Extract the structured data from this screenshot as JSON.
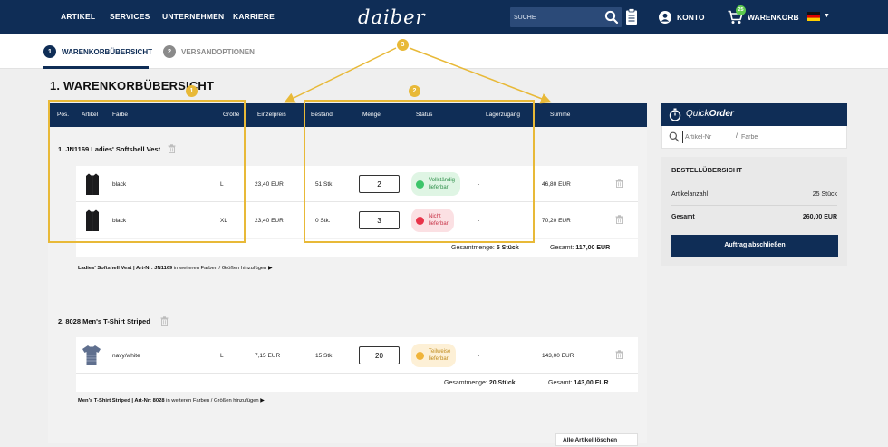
{
  "nav": {
    "links": [
      "ARTIKEL",
      "SERVICES",
      "UNTERNEHMEN",
      "KARRIERE"
    ],
    "logo": "daiber",
    "search_placeholder": "SUCHE",
    "account_label": "KONTO",
    "cart_label": "WARENKORB",
    "cart_count": "25"
  },
  "steps": [
    {
      "num": "1",
      "label": "WARENKORBÜBERSICHT"
    },
    {
      "num": "2",
      "label": "VERSANDOPTIONEN"
    }
  ],
  "page_title": "1. WARENKORBÜBERSICHT",
  "table_headers": {
    "pos": "Pos.",
    "artikel": "Artikel",
    "farbe": "Farbe",
    "groesse": "Größe",
    "einzelpreis": "Einzelpreis",
    "bestand": "Bestand",
    "menge": "Menge",
    "status": "Status",
    "lagerzugang": "Lagerzugang",
    "summe": "Summe"
  },
  "groups": [
    {
      "title": "1. JN1169 Ladies' Softshell Vest",
      "rows": [
        {
          "farbe": "black",
          "groesse": "L",
          "preis": "23,40 EUR",
          "bestand": "51 Stk.",
          "menge": "2",
          "status": "Vollständig lieferbar",
          "status_line1": "Vollständig",
          "status_line2": "lieferbar",
          "lager": "-",
          "summe": "46,80 EUR"
        },
        {
          "farbe": "black",
          "groesse": "XL",
          "preis": "23,40 EUR",
          "bestand": "0 Stk.",
          "menge": "3",
          "status": "Nicht lieferbar",
          "status_line1": "Nicht",
          "status_line2": "lieferbar",
          "lager": "-",
          "summe": "70,20 EUR"
        }
      ],
      "total_qty_label": "Gesamtmenge:",
      "total_qty": "5 Stück",
      "total_sum_label": "Gesamt:",
      "total_sum": "117,00 EUR",
      "add_more_bold": "Ladies' Softshell Vest | Art-Nr: JN1169",
      "add_more_rest": " in weiteren Farben / Größen hinzufügen"
    },
    {
      "title": "2. 8028 Men's T-Shirt Striped",
      "rows": [
        {
          "farbe": "navy/white",
          "groesse": "L",
          "preis": "7,15 EUR",
          "bestand": "15 Stk.",
          "menge": "20",
          "status": "Teilweise lieferbar",
          "status_line1": "Teilweise",
          "status_line2": "lieferbar",
          "lager": "-",
          "summe": "143,00 EUR"
        }
      ],
      "total_qty_label": "Gesamtmenge:",
      "total_qty": "20 Stück",
      "total_sum_label": "Gesamt:",
      "total_sum": "143,00 EUR",
      "add_more_bold": "Men's T-Shirt Striped | Art-Nr: 8028",
      "add_more_rest": " in weiteren Farben / Größen hinzufügen"
    }
  ],
  "annotations": [
    "1",
    "2",
    "3"
  ],
  "quickorder": {
    "title_light": "Quick",
    "title_bold": "Order",
    "artikel_placeholder": "Artikel-Nr",
    "separator": "/",
    "farbe_placeholder": "Farbe"
  },
  "summary": {
    "title": "BESTELLÜBERSICHT",
    "count_label": "Artikelanzahl",
    "count_value": "25 Stück",
    "total_label": "Gesamt",
    "total_value": "260,00 EUR",
    "checkout_label": "Auftrag abschließen"
  },
  "delete_all_label": "Alle Artikel löschen",
  "colors": {
    "navy": "#0f2d56",
    "annotation": "#e8b938",
    "status_green": "#3cc56a",
    "status_red": "#e8344a",
    "status_orange": "#f0b43a"
  }
}
